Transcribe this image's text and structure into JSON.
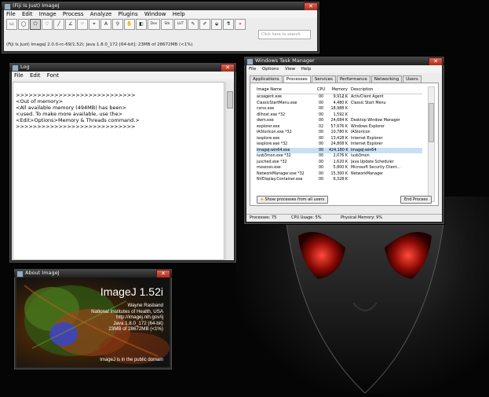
{
  "imagej": {
    "title": "(Fiji Is Just) ImageJ",
    "menu": [
      "File",
      "Edit",
      "Image",
      "Process",
      "Analyze",
      "Plugins",
      "Window",
      "Help"
    ],
    "tools": [
      "rectangle-tool",
      "oval-tool",
      "polygon-tool",
      "freehand-tool",
      "line-tool",
      "angle-tool",
      "point-tool",
      "wand-tool",
      "text-tool",
      "magnifier-tool",
      "hand-tool",
      "color-picker-tool"
    ],
    "tools_right": [
      "Dev",
      "Stk",
      "LUT"
    ],
    "search_placeholder": "Click here to search",
    "status": "(Fiji Is Just) ImageJ 2.0.0-rc-69/1.52i; Java 1.8.0_172 [64-bit]; 23MB of 28672MB (<1%)"
  },
  "log": {
    "title": "Log",
    "menu": [
      "File",
      "Edit",
      "Font"
    ],
    "lines": [
      ">>>>>>>>>>>>>>>>>>>>>>>>>>>>",
      "<Out of memory>",
      "<All available memory (494MB) has been>",
      "<used. To make more available, use the>",
      "<Edit>Options>Memory & Threads command.>",
      ">>>>>>>>>>>>>>>>>>>>>>>>>>>>"
    ]
  },
  "taskmgr": {
    "title": "Windows Task Manager",
    "menu": [
      "File",
      "Options",
      "View",
      "Help"
    ],
    "tabs": [
      "Applications",
      "Processes",
      "Services",
      "Performance",
      "Networking",
      "Users"
    ],
    "active_tab": "Processes",
    "columns": [
      "Image Name",
      "CPU",
      "Memory (...",
      "Description"
    ],
    "rows": [
      [
        "acsagent.exe",
        "00",
        "9,912 K",
        "ActivClient Agent"
      ],
      [
        "ClassicStartMenu.exe",
        "00",
        "4,480 K",
        "Classic Start Menu"
      ],
      [
        "csrss.exe",
        "00",
        "18,988 K",
        ""
      ],
      [
        "dllhost.exe *32",
        "00",
        "1,592 K",
        ""
      ],
      [
        "dwm.exe",
        "00",
        "24,684 K",
        "Desktop Window Manager"
      ],
      [
        "explorer.exe",
        "02",
        "57,976 K",
        "Windows Explorer"
      ],
      [
        "IAStorIcon.exe *32",
        "00",
        "10,780 K",
        "IAStorIcon"
      ],
      [
        "iexplore.exe",
        "00",
        "13,428 K",
        "Internet Explorer"
      ],
      [
        "iexplore.exe *32",
        "00",
        "24,808 K",
        "Internet Explorer"
      ],
      [
        "ImageJ-win64.exe",
        "00",
        "424,180 K",
        "ImageJ-win64"
      ],
      [
        "iusb3mon.exe *32",
        "00",
        "2,076 K",
        "iusb3mon"
      ],
      [
        "jusched.exe *32",
        "00",
        "1,620 K",
        "Java Update Scheduler"
      ],
      [
        "msseces.exe",
        "00",
        "5,800 K",
        "Microsoft Security Client..."
      ],
      [
        "NetworkManager.exe *32",
        "00",
        "15,300 K",
        "NetworkManager"
      ],
      [
        "NVDisplay.Container.exe",
        "00",
        "6,328 K",
        ""
      ]
    ],
    "selected_row": 9,
    "show_all_label": "Show processes from all users",
    "end_process_label": "End Process",
    "status": [
      "Processes: 75",
      "CPU Usage: 5%",
      "Physical Memory: 9%"
    ]
  },
  "about": {
    "title": "About ImageJ",
    "heading": "ImageJ 1.52i",
    "lines": [
      "Wayne Rasband",
      "National Institutes of Health, USA",
      "http://imagej.nih.gov/ij",
      "Java 1.8.0_172 (64-bit)",
      "23MB of 28672MB (<1%)"
    ],
    "footer": "ImageJ is in the public domain"
  }
}
